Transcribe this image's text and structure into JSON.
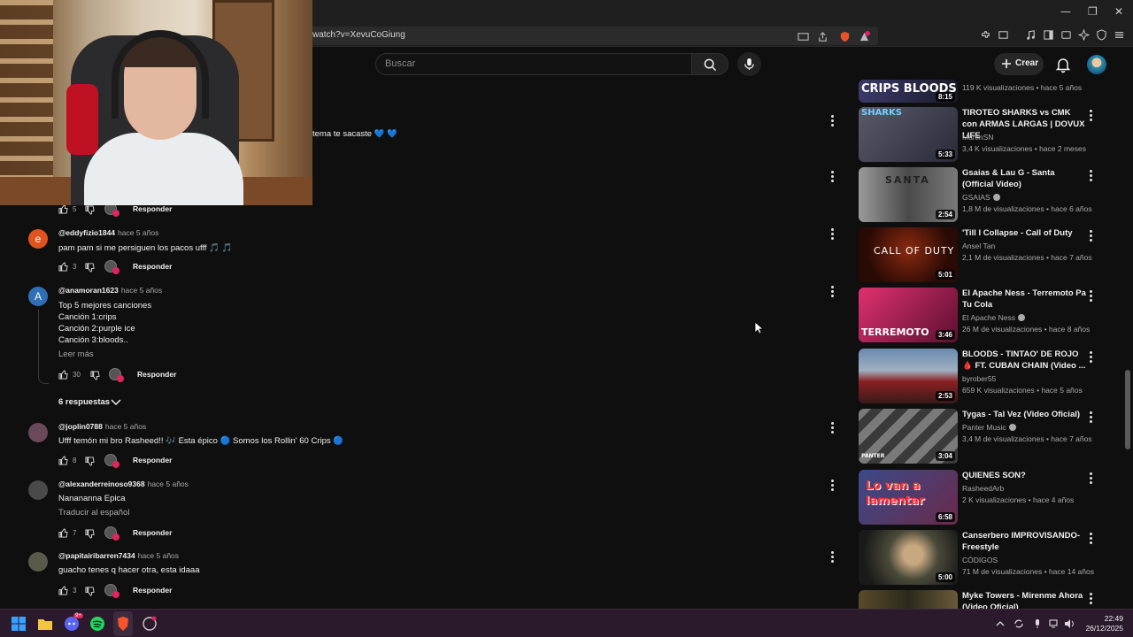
{
  "browser": {
    "url": "watch?v=XevuCoGiung",
    "window_controls": {
      "minimize": "—",
      "restore": "❐",
      "close": "✕"
    },
    "shield_badge": "1"
  },
  "header": {
    "search_placeholder": "Buscar",
    "create_label": "Crear"
  },
  "partial_comment_text": "tema te sacaste 💙 💙",
  "top_actions": {
    "likes": "5",
    "reply": "Responder"
  },
  "comments": [
    {
      "initial": "e",
      "handle": "@eddyfizio1844",
      "time": "hace 5 años",
      "lines": [
        "pam pam si me persiguen los pacos ufff 🎵 🎵"
      ],
      "likes": "3",
      "reply": "Responder",
      "color": "#e0531f"
    },
    {
      "initial": "A",
      "handle": "@anamoran1623",
      "time": "hace 5 años",
      "lines": [
        "Top 5 mejores canciones",
        "Canción 1:crips",
        "Canción 2:purple ice",
        "Canción 3:bloods.."
      ],
      "read_more": "Leer más",
      "likes": "30",
      "reply": "Responder",
      "replies": "6 respuestas",
      "color": "#2f6fb5"
    },
    {
      "initial": "",
      "handle": "@joplin0788",
      "time": "hace 5 años",
      "lines": [
        "Ufff temón mi bro Rasheed!! 🎶 Esta épico 🔵 Somos los Rollin' 60 Crips 🔵"
      ],
      "likes": "8",
      "reply": "Responder",
      "color": "#6a4a5a"
    },
    {
      "initial": "",
      "handle": "@alexanderreinoso9368",
      "time": "hace 5 años",
      "lines": [
        "Nanananna Epica"
      ],
      "translate": "Traducir al español",
      "likes": "7",
      "reply": "Responder",
      "color": "#4a4a4a"
    },
    {
      "initial": "",
      "handle": "@papitairibarren7434",
      "time": "hace 5 años",
      "lines": [
        "guacho tenes q hacer otra, esta idaaa"
      ],
      "likes": "3",
      "reply": "Responder",
      "color": "#5a5a4a"
    }
  ],
  "sidebar": {
    "videos": [
      {
        "title": "",
        "channel": "",
        "stats": "119 K visualizaciones • hace 5 años",
        "duration": "8:15",
        "thumb_text": "CRIPS BLOODS",
        "colors": [
          "#3a3a6a",
          "#1a1a2a"
        ]
      },
      {
        "title": "TIROTEO SHARKS vs CMK con ARMAS LARGAS | DOVUX LIFE",
        "channel": "MartinSN",
        "stats": "3,4 K visualizaciones • hace 2 meses",
        "duration": "5:33",
        "thumb_text": "SHARKS",
        "colors": [
          "#4a4a5a",
          "#2a2a3a"
        ]
      },
      {
        "title": "Gsaias & Lau G - Santa (Official Video)",
        "channel": "GSAIAS",
        "verified": true,
        "stats": "1,8 M de visualizaciones • hace 6 años",
        "duration": "2:54",
        "thumb_text": "SANTA",
        "colors": [
          "#8a8a8a",
          "#3a3a3a"
        ]
      },
      {
        "title": "'Till I Collapse - Call of Duty",
        "channel": "Ansel Tan",
        "stats": "2,1 M de visualizaciones • hace 7 años",
        "duration": "5:01",
        "thumb_text": "CALL OF DUTY",
        "colors": [
          "#6a1a10",
          "#2a0a05"
        ]
      },
      {
        "title": "El Apache Ness - Terremoto Pa Tu Cola",
        "channel": "El Apache Ness",
        "verified": true,
        "stats": "26 M de visualizaciones • hace 8 años",
        "duration": "3:46",
        "thumb_text": "TERREMOTO",
        "colors": [
          "#c02060",
          "#5a1030"
        ]
      },
      {
        "title": "BLOODS - TINTAO' DE ROJO 🩸 FT. CUBAN CHAIN (Video ...",
        "channel": "byrober55",
        "stats": "659 K visualizaciones • hace 5 años",
        "duration": "2:53",
        "thumb_text": "",
        "colors": [
          "#5a7aa0",
          "#8a2020"
        ]
      },
      {
        "title": "Tygas - Tal Vez (Video Oficial)",
        "channel": "Panter Music",
        "verified": true,
        "stats": "3,4 M de visualizaciones • hace 7 años",
        "duration": "3:04",
        "thumb_text": "PANTER",
        "colors": [
          "#6a6a6a",
          "#2a2a2a"
        ]
      },
      {
        "title": "QUIENES SON?",
        "channel": "RasheedArb",
        "stats": "2 K visualizaciones • hace 4 años",
        "duration": "6:58",
        "thumb_text": "Lo van a lamentar",
        "colors": [
          "#3a4a8a",
          "#c02020"
        ]
      },
      {
        "title": "Canserbero IMPROVISANDO- Freestyle",
        "channel": "CÓDIGOS",
        "stats": "71 M de visualizaciones • hace 14 años",
        "duration": "5:00",
        "thumb_text": "",
        "colors": [
          "#4a4a3a",
          "#1a1a1a"
        ]
      },
      {
        "title": "Myke Towers - Mirenme Ahora (Video Oficial)",
        "channel": "",
        "stats": "",
        "duration": "",
        "thumb_text": "",
        "colors": [
          "#5a4a2a",
          "#2a2a1a"
        ]
      }
    ]
  },
  "taskbar": {
    "time": "22:49",
    "date": "26/12/2025",
    "discord_badge": "9+"
  }
}
